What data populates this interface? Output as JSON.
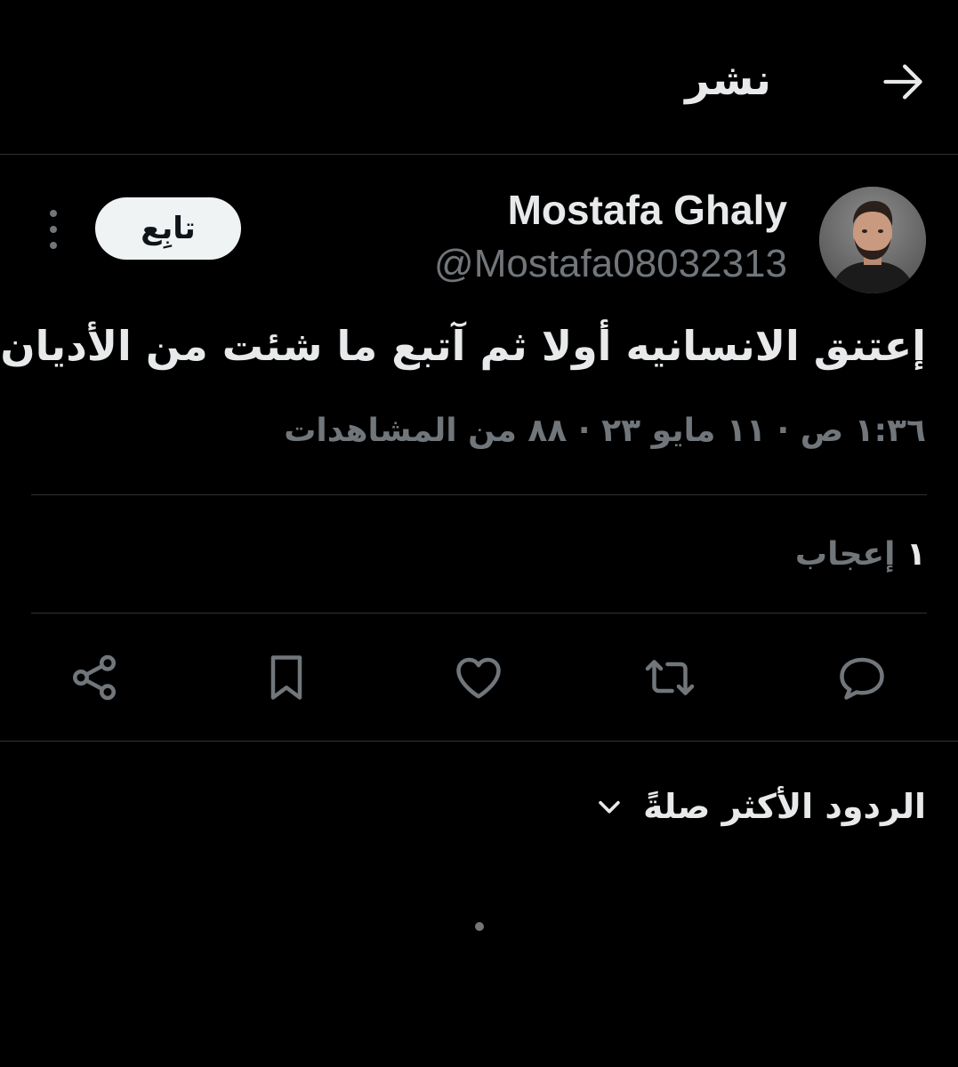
{
  "header": {
    "title": "نشر",
    "back_icon": "arrow-back-icon"
  },
  "author": {
    "name": "Mostafa Ghaly",
    "handle": "@Mostafa08032313",
    "follow_label": "تابِع"
  },
  "tweet": {
    "text": "إعتنق الانسانيه أولا ثم آتبع ما شئت من الأديان.",
    "meta": "١:٣٦ ص · ١١ مايو ٢٣ · ٨٨ من المشاهدات"
  },
  "engagement": {
    "likes_count": "١",
    "likes_label": "إعجاب"
  },
  "actions": [
    "reply-icon",
    "retweet-icon",
    "like-icon",
    "bookmark-icon",
    "share-icon"
  ],
  "replies": {
    "sort_label": "الردود الأكثر صلةً"
  },
  "colors": {
    "background": "#000000",
    "primary_text": "#e7e9ea",
    "secondary_text": "#71767b",
    "divider": "#2f3336",
    "follow_button_bg": "#eff3f4"
  }
}
